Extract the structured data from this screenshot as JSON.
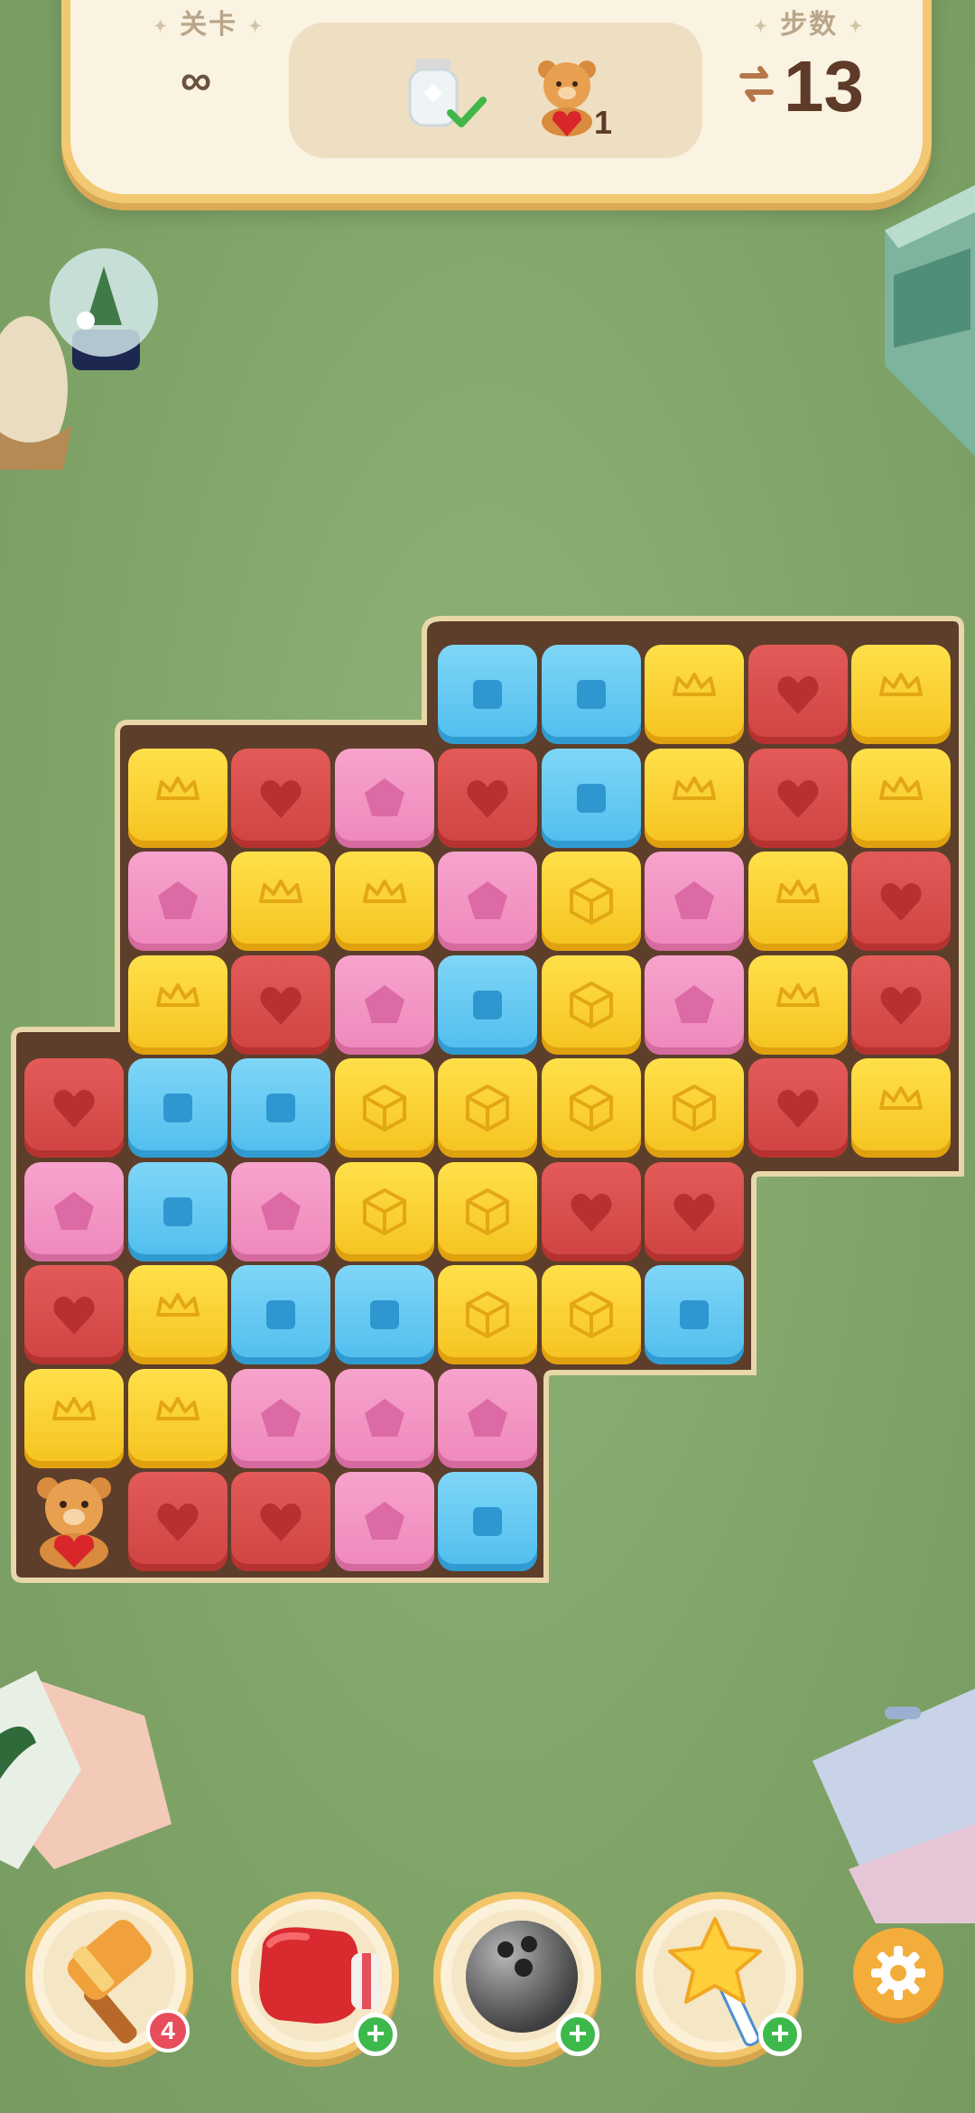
{
  "header": {
    "level_label": "关卡",
    "level_value": "∞",
    "moves_label": "步数",
    "moves_value": "13",
    "goals": [
      {
        "name": "jar",
        "status": "complete"
      },
      {
        "name": "bear",
        "count": "1"
      }
    ]
  },
  "board": {
    "grid": [
      [
        null,
        null,
        null,
        null,
        "blue",
        "blue",
        "yellow",
        "red",
        "yellow"
      ],
      [
        null,
        "yellow",
        "red",
        "pink",
        "red",
        "blue",
        "yellow",
        "red",
        "yellow"
      ],
      [
        null,
        "pink",
        "yellow",
        "yellow",
        "pink",
        "yellow-box",
        "pink",
        "yellow",
        "red"
      ],
      [
        null,
        "yellow",
        "red",
        "pink",
        "blue",
        "yellow-box",
        "pink",
        "yellow",
        "red"
      ],
      [
        "red",
        "blue",
        "blue",
        "yellow-box",
        "yellow-box",
        "yellow-box",
        "yellow-box",
        "red",
        "yellow"
      ],
      [
        "pink",
        "blue",
        "pink",
        "yellow-box",
        "yellow-box",
        "red",
        "red",
        null,
        null
      ],
      [
        "red",
        "yellow",
        "blue",
        "blue",
        "yellow-box",
        "yellow-box",
        "blue",
        null,
        null
      ],
      [
        "yellow",
        "yellow",
        "pink",
        "pink",
        "pink",
        null,
        null,
        null,
        null
      ],
      [
        "bear",
        "red",
        "red",
        "pink",
        "blue",
        null,
        null,
        null,
        null
      ]
    ]
  },
  "boosters": [
    {
      "name": "hammer",
      "count": "4"
    },
    {
      "name": "boxing-glove",
      "badge": "+"
    },
    {
      "name": "bowling-ball",
      "badge": "+"
    },
    {
      "name": "star-wand",
      "badge": "+"
    }
  ],
  "colors": {
    "yellow": "#f5c21f",
    "red": "#cf4441",
    "pink": "#ee88bb",
    "blue": "#4fbdee",
    "background": "#86a86e",
    "panel": "#fbf3e1"
  }
}
